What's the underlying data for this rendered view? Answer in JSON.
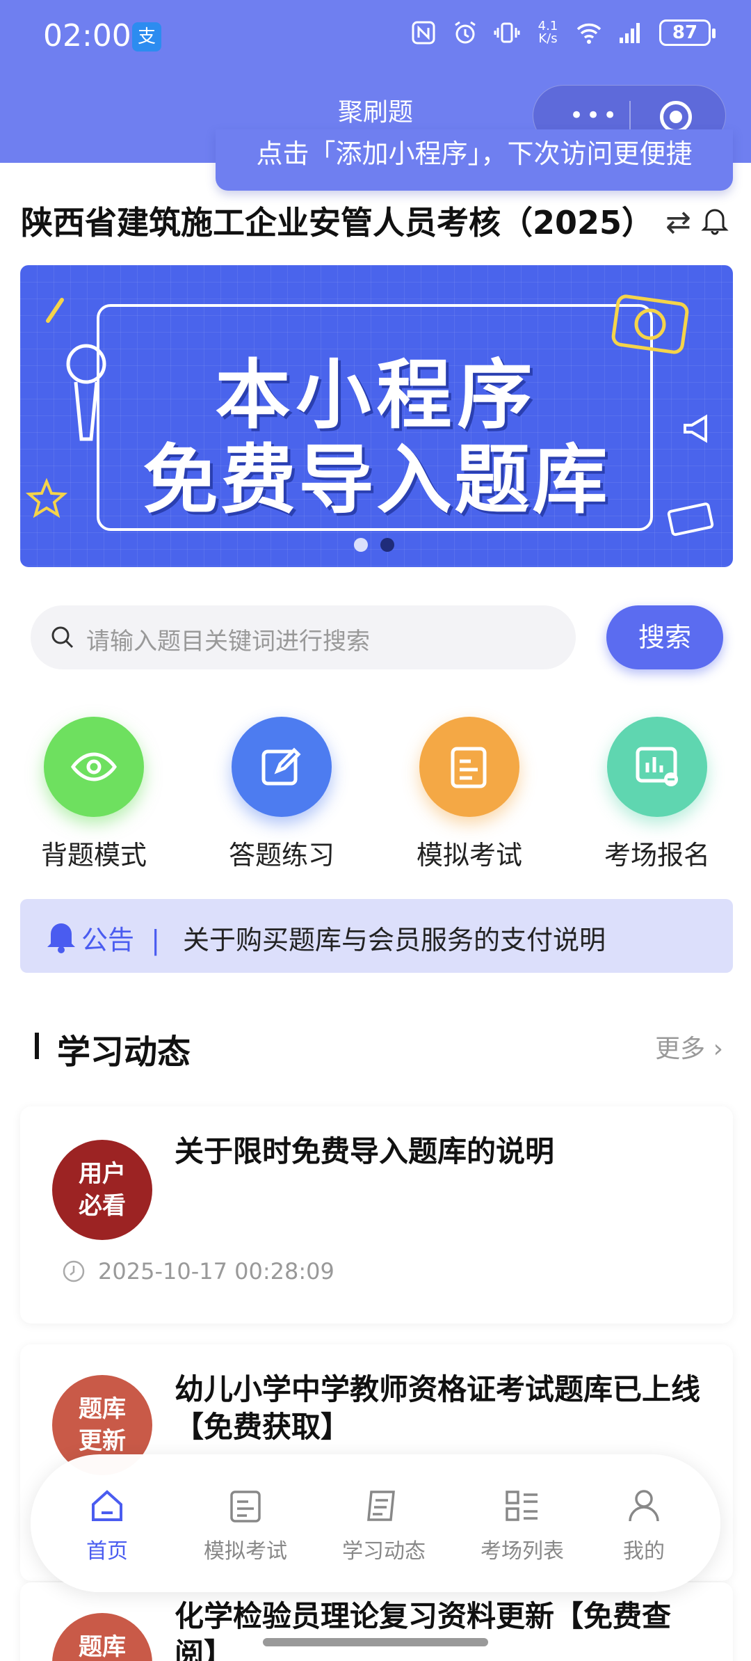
{
  "status_bar": {
    "time": "02:00",
    "alipay_icon": "支",
    "net_speed": "4.1 K/s",
    "battery": "87"
  },
  "miniprogram": {
    "title": "聚刷题",
    "tip": "点击「添加小程序」，下次访问更便捷"
  },
  "header": {
    "title": "陕西省建筑施工企业安管人员考核（2025）"
  },
  "banner": {
    "line1": "本小程序",
    "line2": "免费导入题库"
  },
  "search": {
    "placeholder": "请输入题目关键词进行搜索",
    "button": "搜索"
  },
  "quick_actions": [
    {
      "label": "背题模式",
      "icon": "eye-icon",
      "color": "#6ee05f"
    },
    {
      "label": "答题练习",
      "icon": "edit-icon",
      "color": "#4d7cf0"
    },
    {
      "label": "模拟考试",
      "icon": "exam-icon",
      "color": "#f4a845"
    },
    {
      "label": "考场报名",
      "icon": "chart-icon",
      "color": "#5fd6b0"
    }
  ],
  "notice": {
    "label": "公告",
    "separator": "|",
    "text": "关于购买题库与会员服务的支付说明"
  },
  "section": {
    "title": "学习动态",
    "more": "更多"
  },
  "articles": [
    {
      "thumb_line1": "用户",
      "thumb_line2": "必看",
      "title": "关于限时免费导入题库的说明",
      "date": "2025-10-17 00:28:09"
    },
    {
      "thumb_line1": "题库",
      "thumb_line2": "更新",
      "title": "幼儿小学中学教师资格证考试题库已上线【免费获取】"
    },
    {
      "thumb_line1": "题库",
      "thumb_line2": "",
      "title": "化学检验员理论复习资料更新【免费查阅】"
    }
  ],
  "tabbar": [
    {
      "label": "首页",
      "icon": "home-icon",
      "active": true
    },
    {
      "label": "模拟考试",
      "icon": "exam-tab-icon"
    },
    {
      "label": "学习动态",
      "icon": "news-icon"
    },
    {
      "label": "考场列表",
      "icon": "list-icon"
    },
    {
      "label": "我的",
      "icon": "user-icon"
    }
  ],
  "colors": {
    "primary": "#5b6cf0",
    "topbar": "#6f7ff0",
    "notice_bg": "#dcdffb"
  }
}
